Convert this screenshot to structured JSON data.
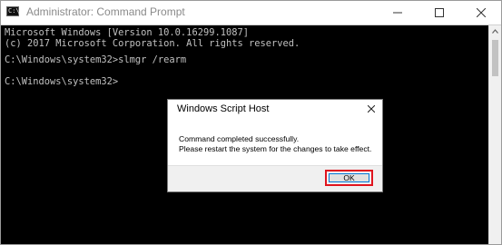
{
  "window": {
    "title": "Administrator: Command Prompt",
    "icon": "cmd-icon",
    "controls": [
      "minimize-icon",
      "maximize-icon",
      "close-icon"
    ]
  },
  "console": {
    "lines": [
      "Microsoft Windows [Version 10.0.16299.1087]",
      "(c) 2017 Microsoft Corporation. All rights reserved.",
      "",
      "C:\\Windows\\system32>slmgr /rearm",
      "",
      "C:\\Windows\\system32>"
    ]
  },
  "dialog": {
    "title": "Windows Script Host",
    "message_line1": "Command completed successfully.",
    "message_line2": "Please restart the system for the changes to take effect.",
    "ok_label": "OK",
    "highlight_color": "#e0141e"
  }
}
